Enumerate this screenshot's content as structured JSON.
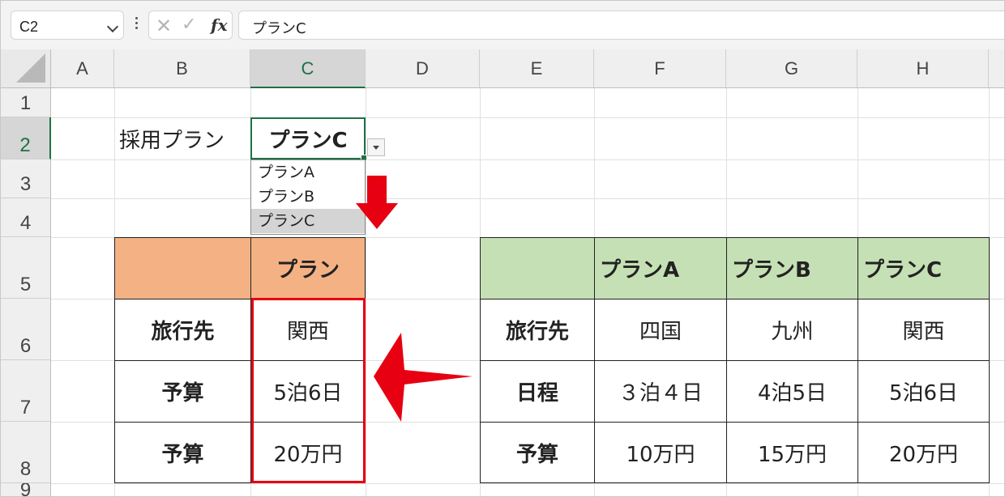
{
  "formula_bar": {
    "name_box": "C2",
    "cancel_glyph": "✕",
    "enter_glyph": "✓",
    "fx_label": "fx",
    "formula": "プランC"
  },
  "columns": [
    "A",
    "B",
    "C",
    "D",
    "E",
    "F",
    "G",
    "H"
  ],
  "rows": [
    "1",
    "2",
    "3",
    "4",
    "5",
    "6",
    "7",
    "8",
    "9"
  ],
  "selected": {
    "column": "C",
    "row": "2"
  },
  "cells": {
    "b2": "採用プラン",
    "c2": "プランC"
  },
  "dropdown": {
    "options": [
      "プランA",
      "プランB",
      "プランC"
    ],
    "highlighted_index": 2
  },
  "left_table": {
    "header": "プラン",
    "header_color": "#F4B183",
    "rows": [
      {
        "label": "旅行先",
        "value": "関西"
      },
      {
        "label": "予算",
        "value": "5泊6日"
      },
      {
        "label": "予算",
        "value": "20万円"
      }
    ]
  },
  "right_table": {
    "header_color": "#C5E0B4",
    "headers": [
      "プランA",
      "プランB",
      "プランC"
    ],
    "rows": [
      {
        "label": "旅行先",
        "values": [
          "四国",
          "九州",
          "関西"
        ]
      },
      {
        "label": "日程",
        "values": [
          "３泊４日",
          "4泊5日",
          "5泊6日"
        ]
      },
      {
        "label": "予算",
        "values": [
          "10万円",
          "15万円",
          "20万円"
        ]
      }
    ]
  },
  "annotation": {
    "color": "#E60012",
    "icons": [
      "arrow-down-icon",
      "arrow-left-icon"
    ]
  }
}
